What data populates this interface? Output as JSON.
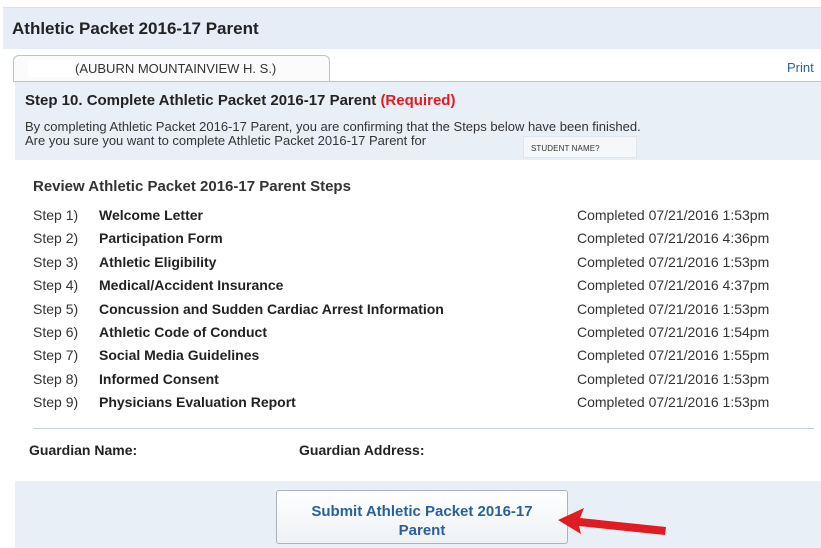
{
  "header": {
    "title": "Athletic Packet 2016-17 Parent"
  },
  "tab": {
    "label": "(AUBURN MOUNTAINVIEW H. S.)"
  },
  "print_label": "Print",
  "step": {
    "title": "Step 10. Complete Athletic Packet 2016-17 Parent",
    "required": "(Required)",
    "line1": "By completing Athletic Packet 2016-17 Parent, you are confirming that the Steps below have been finished.",
    "line2": "Are you sure you want to complete Athletic Packet 2016-17 Parent for",
    "student_placeholder": "STUDENT NAME?"
  },
  "review": {
    "title": "Review Athletic Packet 2016-17 Parent Steps",
    "steps": [
      {
        "num": "Step 1)",
        "name": "Welcome Letter",
        "status": "Completed 07/21/2016 1:53pm"
      },
      {
        "num": "Step 2)",
        "name": "Participation Form",
        "status": "Completed 07/21/2016 4:36pm"
      },
      {
        "num": "Step 3)",
        "name": "Athletic Eligibility",
        "status": "Completed 07/21/2016 1:53pm"
      },
      {
        "num": "Step 4)",
        "name": "Medical/Accident Insurance",
        "status": "Completed 07/21/2016 4:37pm"
      },
      {
        "num": "Step 5)",
        "name": "Concussion and Sudden Cardiac Arrest Information",
        "status": "Completed 07/21/2016 1:53pm"
      },
      {
        "num": "Step 6)",
        "name": "Athletic Code of Conduct",
        "status": "Completed 07/21/2016 1:54pm"
      },
      {
        "num": "Step 7)",
        "name": "Social Media Guidelines",
        "status": "Completed 07/21/2016 1:55pm"
      },
      {
        "num": "Step 8)",
        "name": "Informed Consent",
        "status": "Completed 07/21/2016 1:53pm"
      },
      {
        "num": "Step 9)",
        "name": "Physicians Evaluation Report",
        "status": "Completed 07/21/2016 1:53pm"
      }
    ]
  },
  "guardian": {
    "name_label": "Guardian Name:",
    "address_label": "Guardian Address:"
  },
  "submit": {
    "label": "Submit Athletic Packet 2016-17 Parent"
  },
  "colors": {
    "link": "#2a5f9e",
    "required": "#e11b22",
    "panel": "#e9eff7",
    "arrow": "#e11b22"
  },
  "icons": {
    "annotation": "red-arrow-icon"
  }
}
